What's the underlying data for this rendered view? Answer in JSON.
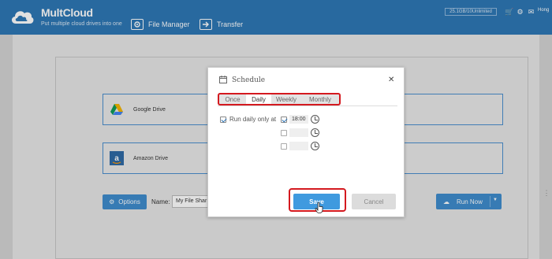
{
  "header": {
    "app_name": "MultCloud",
    "tagline": "Put multiple cloud drives into one",
    "nav": [
      {
        "label": "File Manager",
        "icon": "gear-icon"
      },
      {
        "label": "Transfer",
        "icon": "arrow-right-icon"
      }
    ],
    "storage_text": "25.1GB/10Unlimited",
    "user_label": "Hong"
  },
  "main": {
    "source_drive": {
      "label": "Google Drive",
      "icon": "google-drive-icon"
    },
    "target_drive": {
      "label": "Amazon Drive",
      "icon": "amazon-drive-icon"
    },
    "options_label": "Options",
    "name_label": "Name:",
    "name_value": "My File Shar",
    "run_label": "Run Now"
  },
  "modal": {
    "title": "Schedule",
    "tabs": [
      "Once",
      "Daily",
      "Weekly",
      "Monthly"
    ],
    "active_tab": "Daily",
    "run_daily_label": "Run daily only at",
    "run_daily_checked": true,
    "times": [
      {
        "checked": true,
        "value": "18:00"
      },
      {
        "checked": false,
        "value": ""
      },
      {
        "checked": false,
        "value": ""
      }
    ],
    "save_label": "Save",
    "cancel_label": "Cancel"
  },
  "colors": {
    "header_bg": "#2e78b6",
    "accent": "#3f8ccd",
    "save_button": "#3f9adf",
    "highlight_ring": "#d4191f"
  }
}
